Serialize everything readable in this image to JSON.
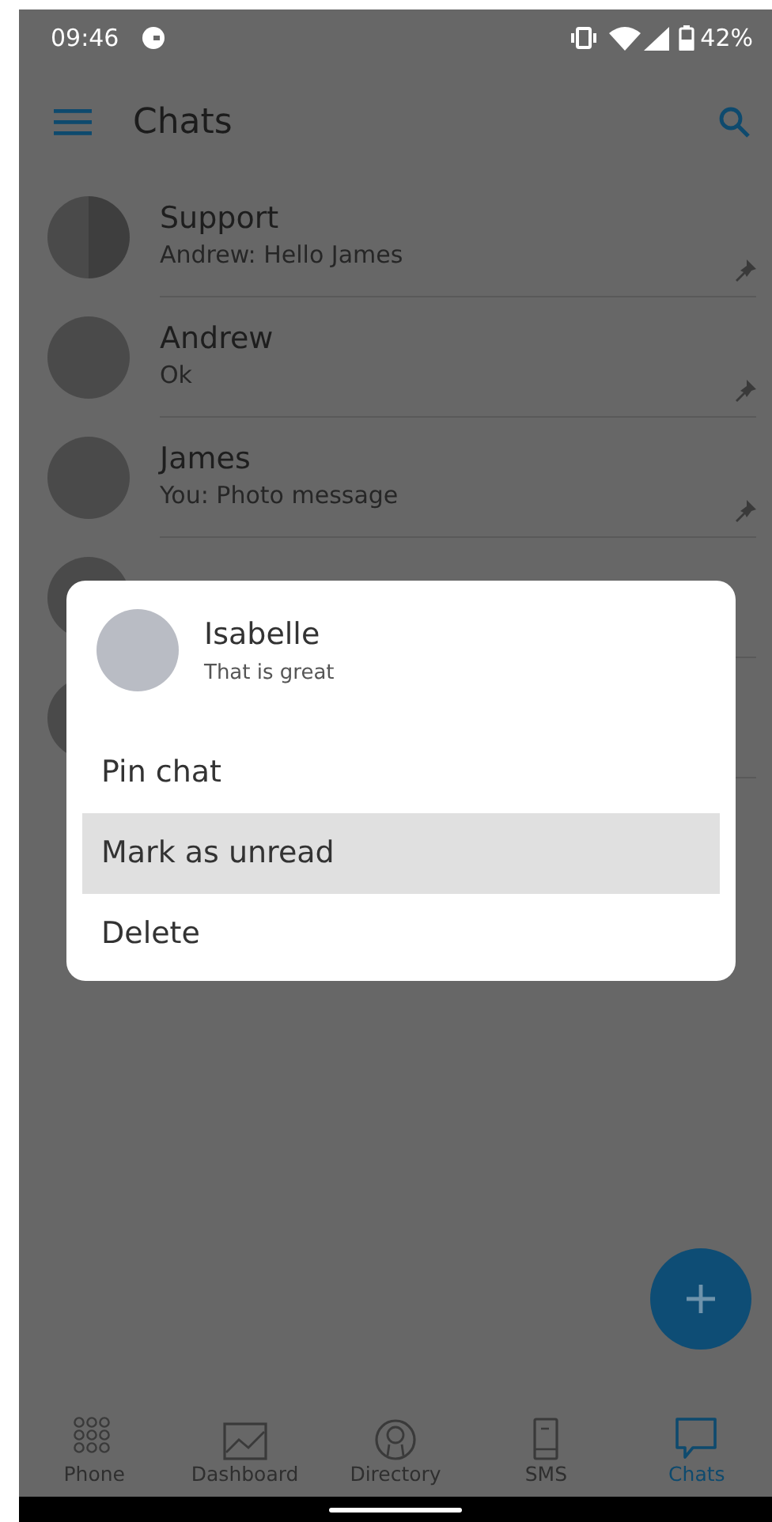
{
  "status_bar": {
    "time": "09:46",
    "battery": "42%"
  },
  "app_bar": {
    "title": "Chats"
  },
  "chats": [
    {
      "name": "Support",
      "preview": "Andrew: Hello James",
      "pinned": true,
      "kind": "group"
    },
    {
      "name": "Andrew",
      "preview": "Ok",
      "pinned": true,
      "kind": "single"
    },
    {
      "name": "James",
      "preview": "You: Photo message",
      "pinned": true,
      "kind": "single"
    },
    {
      "kind": "single",
      "pinned": false
    },
    {
      "kind": "single",
      "pinned": false
    }
  ],
  "dialog": {
    "name": "Isabelle",
    "preview": "That is great",
    "items": [
      {
        "label": "Pin chat",
        "selected": false
      },
      {
        "label": "Mark as unread",
        "selected": true
      },
      {
        "label": "Delete",
        "selected": false
      }
    ]
  },
  "bottom_nav": [
    {
      "label": "Phone",
      "kind": "dialpad",
      "selected": false
    },
    {
      "label": "Dashboard",
      "kind": "chart",
      "selected": false
    },
    {
      "label": "Directory",
      "kind": "person",
      "selected": false
    },
    {
      "label": "SMS",
      "kind": "mobile",
      "selected": false
    },
    {
      "label": "Chats",
      "kind": "bubble",
      "selected": true
    }
  ]
}
